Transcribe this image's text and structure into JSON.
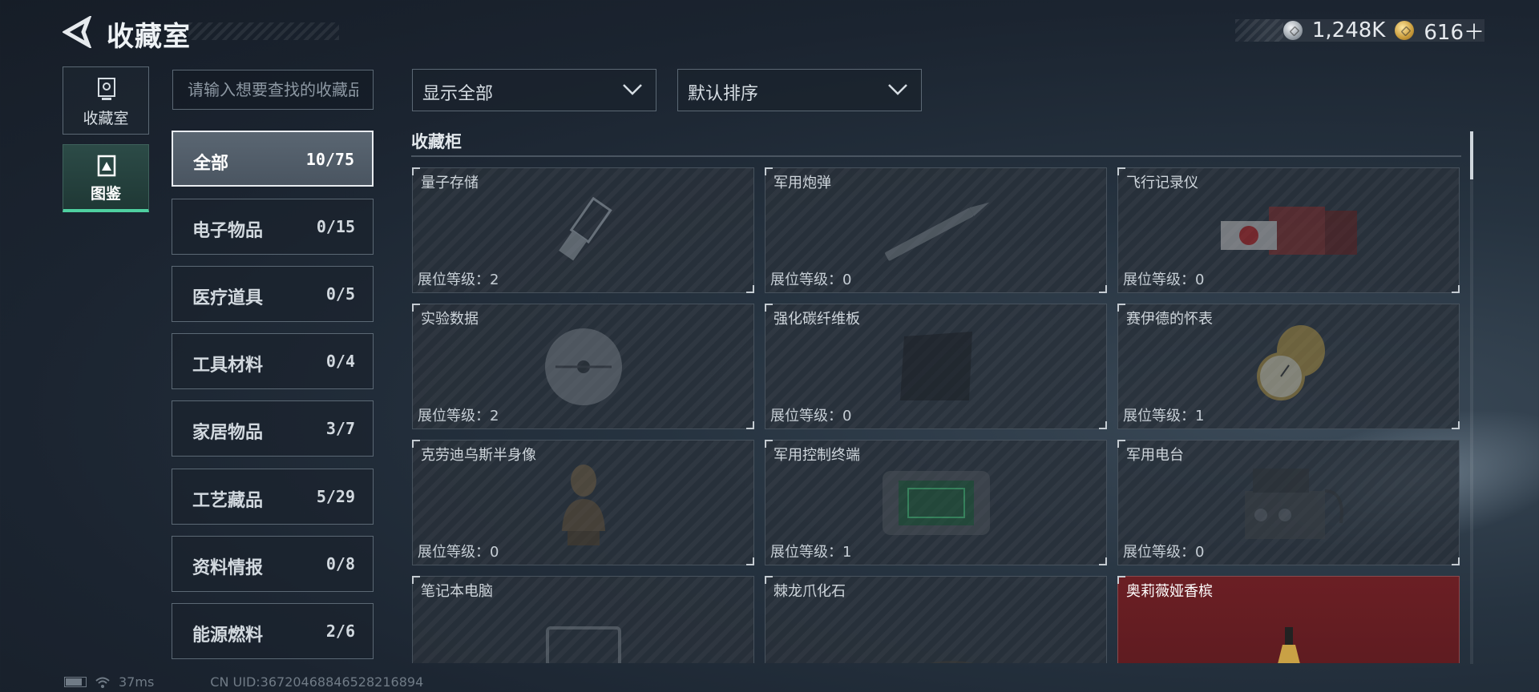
{
  "header": {
    "title": "收藏室",
    "currency": [
      {
        "icon": "silver-coin-icon",
        "value": "1,248K"
      },
      {
        "icon": "gold-coin-icon",
        "value": "616＋"
      }
    ]
  },
  "nav": {
    "items": [
      {
        "label": "收藏室",
        "icon": "collection-room-icon",
        "active": false
      },
      {
        "label": "图鉴",
        "icon": "codex-icon",
        "active": true
      }
    ]
  },
  "search": {
    "placeholder": "请输入想要查找的收藏品",
    "value": ""
  },
  "categories": [
    {
      "label": "全部",
      "count": "10/75",
      "active": true
    },
    {
      "label": "电子物品",
      "count": "0/15"
    },
    {
      "label": "医疗道具",
      "count": "0/5"
    },
    {
      "label": "工具材料",
      "count": "0/4"
    },
    {
      "label": "家居物品",
      "count": "3/7"
    },
    {
      "label": "工艺藏品",
      "count": "5/29"
    },
    {
      "label": "资料情报",
      "count": "0/8"
    },
    {
      "label": "能源燃料",
      "count": "2/6"
    }
  ],
  "filters": {
    "display": {
      "selected": "显示全部"
    },
    "sort": {
      "selected": "默认排序"
    }
  },
  "section": {
    "title": "收藏柜"
  },
  "items": [
    {
      "name": "量子存储",
      "level": "展位等级：2",
      "icon": "usb-drive-icon"
    },
    {
      "name": "军用炮弹",
      "level": "展位等级：0",
      "icon": "shell-icon"
    },
    {
      "name": "飞行记录仪",
      "level": "展位等级：0",
      "icon": "flight-recorder-icon"
    },
    {
      "name": "实验数据",
      "level": "展位等级：2",
      "icon": "disc-icon"
    },
    {
      "name": "强化碳纤维板",
      "level": "展位等级：0",
      "icon": "carbon-plate-icon"
    },
    {
      "name": "赛伊德的怀表",
      "level": "展位等级：1",
      "icon": "pocket-watch-icon"
    },
    {
      "name": "克劳迪乌斯半身像",
      "level": "展位等级：0",
      "icon": "bust-icon"
    },
    {
      "name": "军用控制终端",
      "level": "展位等级：1",
      "icon": "control-terminal-icon"
    },
    {
      "name": "军用电台",
      "level": "展位等级：0",
      "icon": "radio-icon"
    },
    {
      "name": "笔记本电脑",
      "level": "",
      "icon": "laptop-icon"
    },
    {
      "name": "棘龙爪化石",
      "level": "",
      "icon": "claw-fossil-icon"
    },
    {
      "name": "奥莉薇娅香槟",
      "level": "",
      "icon": "champagne-bottle-icon",
      "highlight": "#6b1f24"
    }
  ],
  "status": {
    "ping": "37ms",
    "uid": "CN UID:36720468846528216894"
  }
}
